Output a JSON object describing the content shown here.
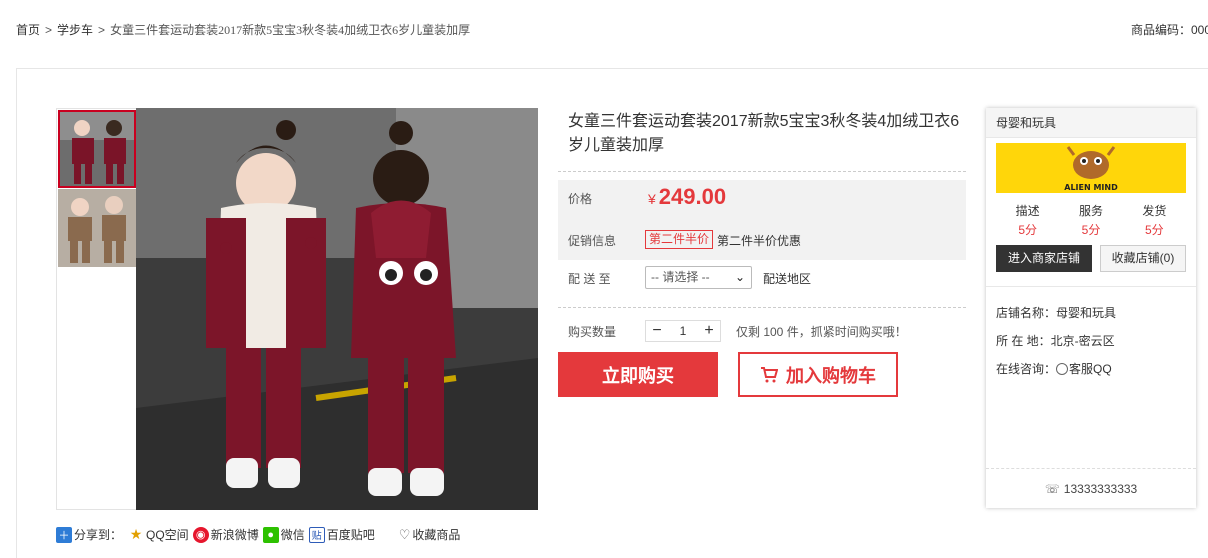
{
  "breadcrumb": {
    "home": "首页",
    "category": "学步车",
    "product": "女童三件套运动套装2017新款5宝宝3秋冬装4加绒卫衣6岁儿童装加厚",
    "separator": ">"
  },
  "product_code_label": "商品编码：000",
  "product": {
    "title": "女童三件套运动套装2017新款5宝宝3秋冬装4加绒卫衣6岁儿童装加厚",
    "price_label": "价格",
    "currency": "¥",
    "price": "249.00",
    "promo_label": "促销信息",
    "promo_tag": "第二件半价",
    "promo_text": "第二件半价优惠",
    "delivery_label": "配 送 至",
    "delivery_select": "-- 请选择 --",
    "delivery_region": "配送地区",
    "qty_label": "购买数量",
    "qty_minus": "−",
    "qty_value": "1",
    "qty_plus": "+",
    "stock_text": "仅剩 100 件，抓紧时间购买哦！",
    "buy_now": "立即购买",
    "add_to_cart": "加入购物车",
    "cart_icon": "cart-icon"
  },
  "share": {
    "label": "分享到：",
    "items": [
      "QQ空间",
      "新浪微博",
      "微信",
      "百度贴吧"
    ],
    "favorite": "收藏商品"
  },
  "shop": {
    "name_header": "母婴和玩具",
    "logo_text": "ALIEN MIND",
    "scores": [
      {
        "label": "描述",
        "value": "5分"
      },
      {
        "label": "服务",
        "value": "5分"
      },
      {
        "label": "发货",
        "value": "5分"
      }
    ],
    "enter_store": "进入商家店铺",
    "collect_store": "收藏店铺(0)",
    "store_name_row": "店铺名称：母婴和玩具",
    "location_row": "所 在 地：北京-密云区",
    "consult_label": "在线咨询：",
    "consult_qq": "客服QQ",
    "phone": "13333333333"
  },
  "colors": {
    "accent": "#e4393c",
    "logo_bg": "#ffd60a",
    "dark_button": "#333333"
  }
}
